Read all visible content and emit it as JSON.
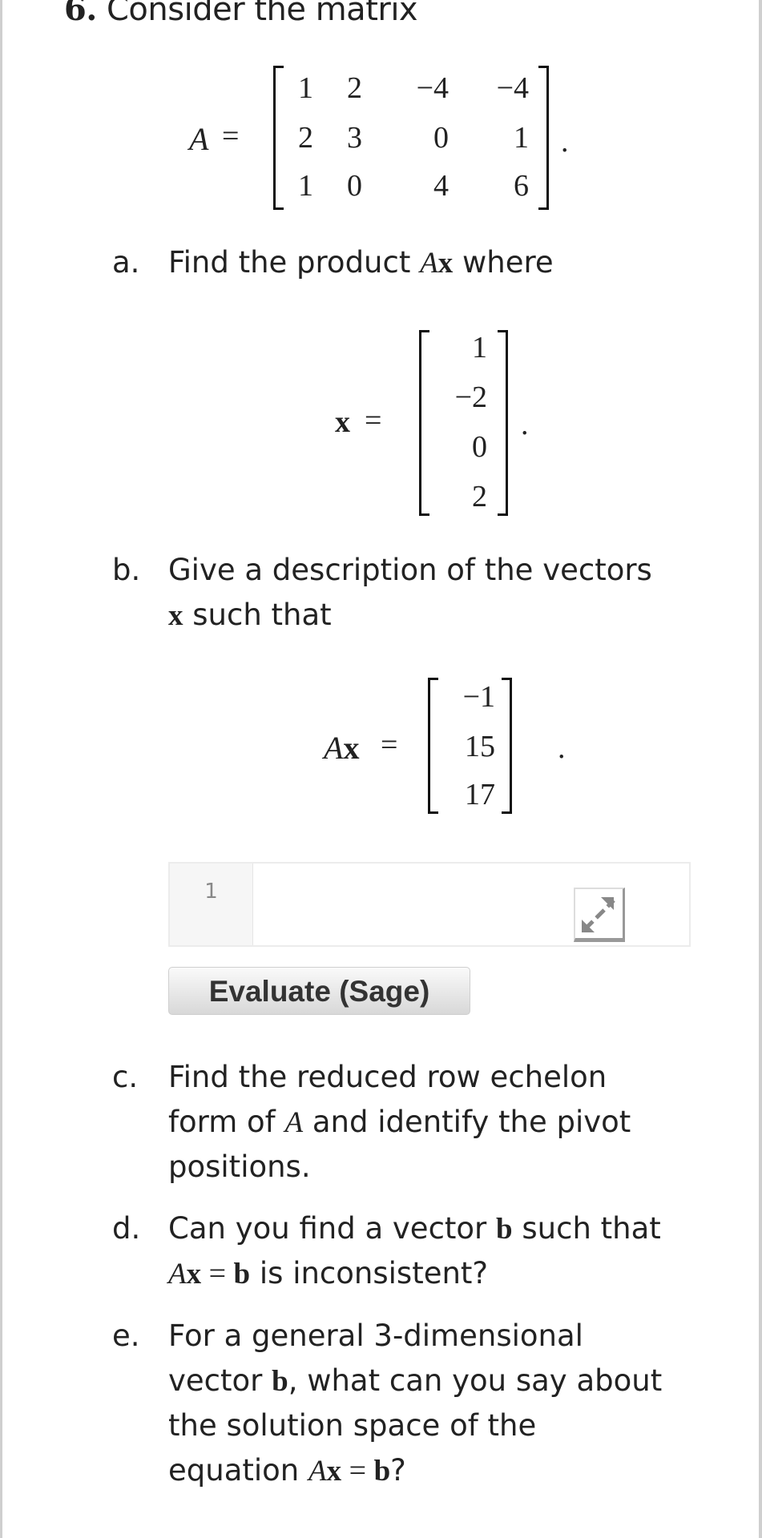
{
  "problem": {
    "number": "6.",
    "intro": "Consider the matrix",
    "matrix_A": {
      "name": "A",
      "rows": [
        [
          "1",
          "2",
          "−4",
          "−4"
        ],
        [
          "2",
          "3",
          "0",
          "1"
        ],
        [
          "1",
          "0",
          "4",
          "6"
        ]
      ]
    },
    "parts": {
      "a": {
        "label": "a.",
        "text_before": "Find the product ",
        "math": "Ax",
        "text_after": " where"
      },
      "vector_x": {
        "name": "x",
        "values": [
          "1",
          "−2",
          "0",
          "2"
        ]
      },
      "b": {
        "label": "b.",
        "line1": "Give a description of the vectors",
        "line2_math": "x",
        "line2_text": " such that"
      },
      "vector_Ax": {
        "lhs": "Ax",
        "values": [
          "−1",
          "15",
          "17"
        ]
      },
      "c": {
        "label": "c.",
        "lines": [
          "Find the reduced row echelon",
          "form of ",
          "A",
          " and identify the pivot",
          "positions."
        ]
      },
      "d": {
        "label": "d.",
        "line1_pre": "Can you find a vector ",
        "line1_math": "b",
        "line1_post": " such that",
        "line2_math": "Ax = b",
        "line2_post": " is inconsistent?"
      },
      "e": {
        "label": "e.",
        "line1": "For a general 3-dimensional",
        "line2_pre": "vector ",
        "line2_math": "b",
        "line2_post": ", what can you say about",
        "line3": "the solution space of the",
        "line4_pre": "equation ",
        "line4_math": "Ax = b",
        "line4_post": "?"
      }
    }
  },
  "sage_cell": {
    "line_number": "1",
    "code": "",
    "expand_icon": "expand-icon",
    "evaluate_label": "Evaluate (Sage)"
  },
  "punct": {
    "equals": "=",
    "period": "."
  }
}
